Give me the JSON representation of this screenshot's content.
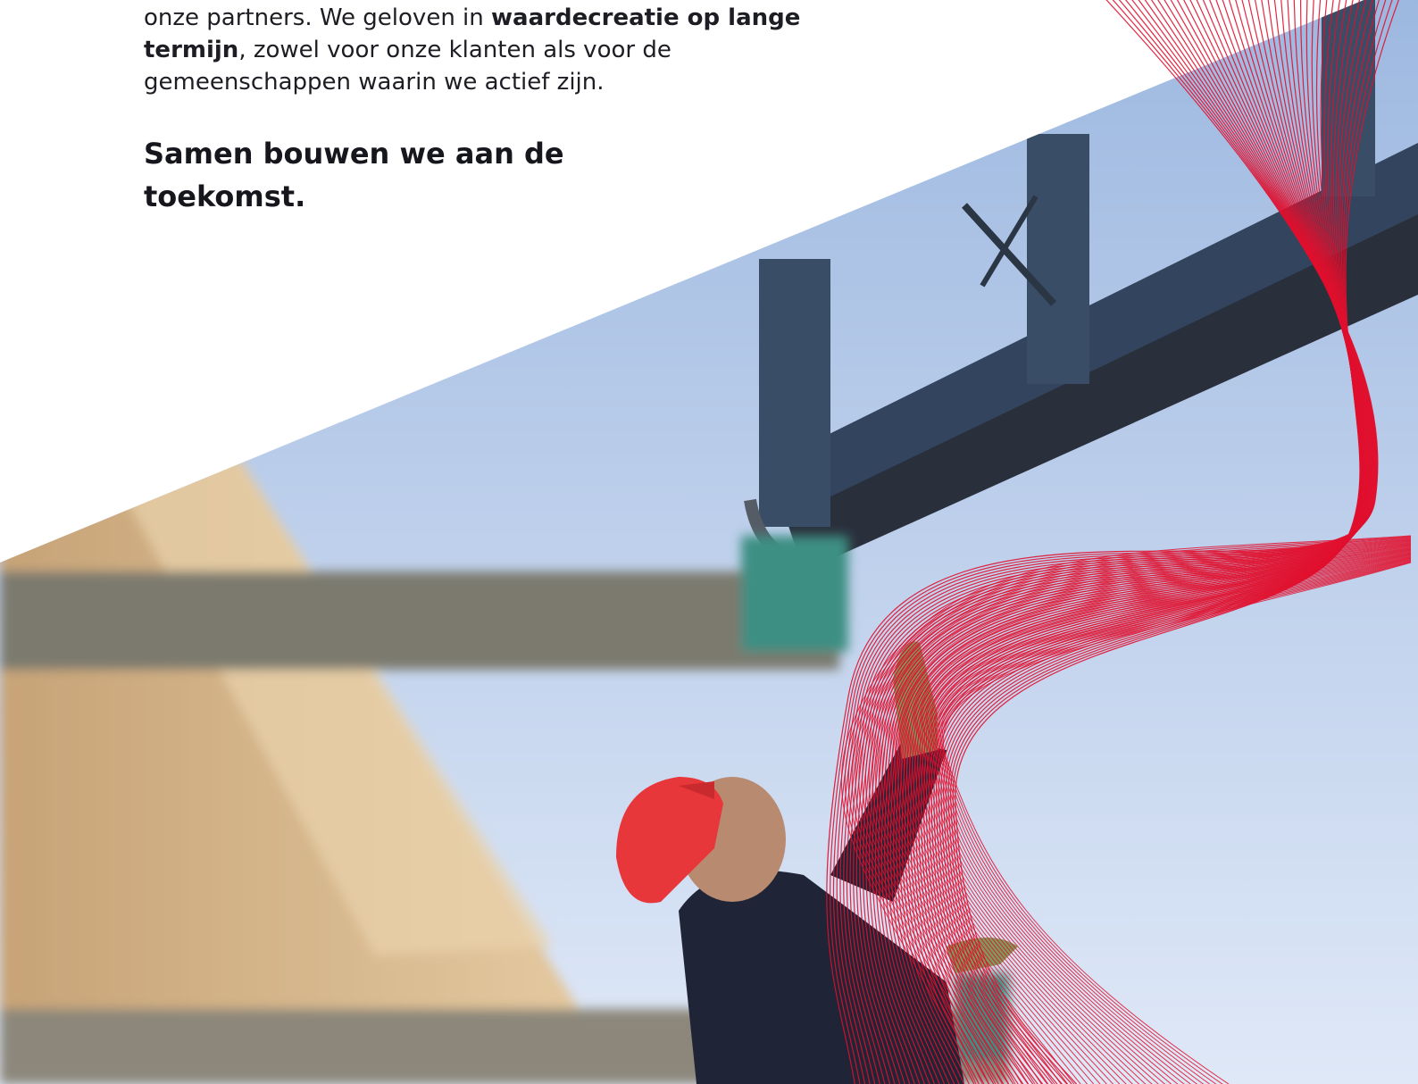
{
  "intro": {
    "t1": "onze partners. We geloven in ",
    "b1": "waardecreatie op lange termijn",
    "t2": ", zowel voor onze klanten als voor de gemeenschappen waarin we actief zijn."
  },
  "tagline": "Samen bouwen we aan de toekomst.",
  "colors": {
    "accent_red": "#e0102e",
    "sky_top": "#9db8e0",
    "sky_bottom": "#dfe8f7",
    "wood": "#d9b98c",
    "steel": "#33455e",
    "helmet": "#e8373a",
    "jacket": "#1f2436"
  }
}
